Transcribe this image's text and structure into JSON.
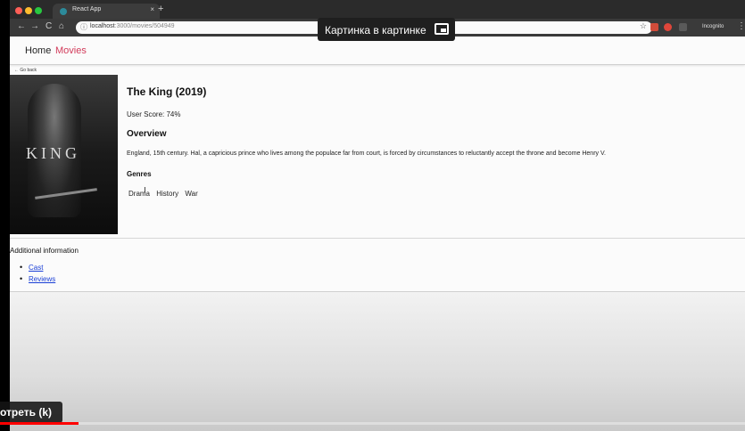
{
  "browser": {
    "tab_title": "React App",
    "tab_close": "×",
    "new_tab": "+",
    "nav": {
      "back": "←",
      "forward": "→",
      "reload": "C",
      "home": "⌂"
    },
    "url_host": "localhost",
    "url_path": ":3000/movies/504949",
    "incognito_label": "Incognito",
    "menu": "⋮",
    "colors": {
      "close": "#ff5f57",
      "minimize": "#febc2e",
      "maximize": "#28c840",
      "ext1": "#d24c3a",
      "ext2": "#e0463a"
    }
  },
  "pip": {
    "label": "Картинка в картинке"
  },
  "nav": {
    "home": "Home",
    "movies": "Movies",
    "active_color": "#d23c5b"
  },
  "movie": {
    "go_back": "← Go back",
    "poster_text": "KING",
    "title": "The King (2019)",
    "user_score": "User Score: 74%",
    "overview_heading": "Overview",
    "overview": "England, 15th century. Hal, a capricious prince who lives among the populace far from court, is forced by circumstances to reluctantly accept the throne and become Henry V.",
    "genres_heading": "Genres",
    "genres": [
      "Drama",
      "History",
      "War"
    ]
  },
  "additional": {
    "heading": "Additional information",
    "links": [
      "Cast",
      "Reviews"
    ]
  },
  "video": {
    "overlay_text": "отреть (k)",
    "progress": 0.105
  }
}
